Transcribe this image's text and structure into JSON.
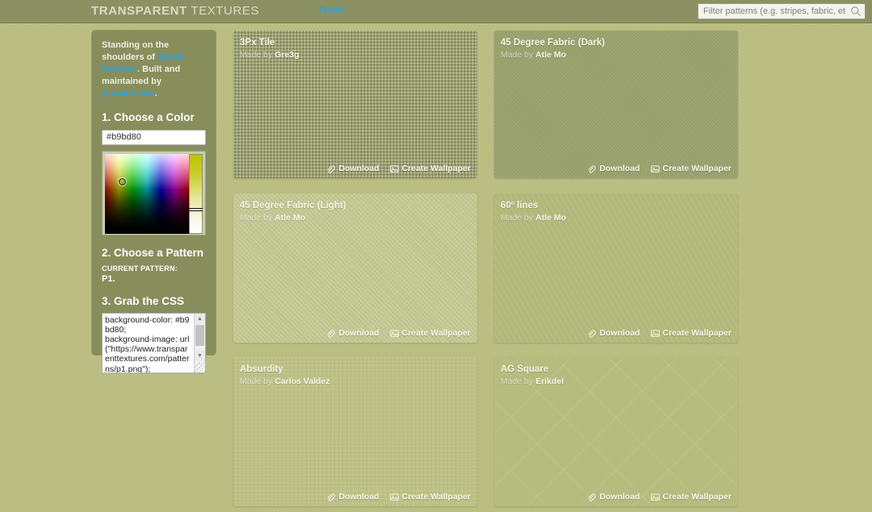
{
  "header": {
    "logo_bold": "TRANSPARENT",
    "logo_light": " TEXTURES",
    "tweet_label": "Tweet",
    "search_placeholder": "Filter patterns (e.g. stripes, fabric, etc.)",
    "search_value": "",
    "search_icon": "search-icon"
  },
  "sidebar": {
    "intro_part1": "Standing on the shoulders of ",
    "intro_link1": "Subtle Patterns",
    "intro_part2": ". Built and maintained by ",
    "intro_link2": "@mikehearn",
    "intro_part3": ".",
    "step1_title": "1. Choose a Color",
    "color_value": "#b9bd80",
    "step2_title": "2. Choose a Pattern",
    "current_pattern_label": "CURRENT PATTERN:",
    "current_pattern_value": "P1.",
    "step3_title": "3. Grab the CSS",
    "css_value": "background-color: #b9bd80;\nbackground-image: url(\"https://www.transparenttextures.com/patterns/p1.png\");"
  },
  "patterns": [
    {
      "title": "3Px Tile",
      "made_by_prefix": "Made by ",
      "author": "Gre3g",
      "download_label": "Download",
      "wallpaper_label": "Create Wallpaper",
      "download_icon": "paperclip-icon",
      "wallpaper_icon": "image-icon"
    },
    {
      "title": "45 Degree Fabric (Dark)",
      "made_by_prefix": "Made by ",
      "author": "Atle Mo",
      "download_label": "Download",
      "wallpaper_label": "Create Wallpaper",
      "download_icon": "paperclip-icon",
      "wallpaper_icon": "image-icon"
    },
    {
      "title": "45 Degree Fabric (Light)",
      "made_by_prefix": "Made by ",
      "author": "Atle Mo",
      "download_label": "Download",
      "wallpaper_label": "Create Wallpaper",
      "download_icon": "paperclip-icon",
      "wallpaper_icon": "image-icon"
    },
    {
      "title": "60º lines",
      "made_by_prefix": "Made by ",
      "author": "Atle Mo",
      "download_label": "Download",
      "wallpaper_label": "Create Wallpaper",
      "download_icon": "paperclip-icon",
      "wallpaper_icon": "image-icon"
    },
    {
      "title": "Absurdity",
      "made_by_prefix": "Made by ",
      "author": "Carlos Valdez",
      "download_label": "Download",
      "wallpaper_label": "Create Wallpaper",
      "download_icon": "paperclip-icon",
      "wallpaper_icon": "image-icon"
    },
    {
      "title": "AG Square",
      "made_by_prefix": "Made by ",
      "author": "Erikdel",
      "download_label": "Download",
      "wallpaper_label": "Create Wallpaper",
      "download_icon": "paperclip-icon",
      "wallpaper_icon": "image-icon"
    }
  ],
  "colors": {
    "page_background": "#b9bd80",
    "topbar": "#8c9163",
    "sidebar_panel": "#888d5c",
    "link_blue": "#29a3e0",
    "text_light": "#f2f4e6"
  }
}
